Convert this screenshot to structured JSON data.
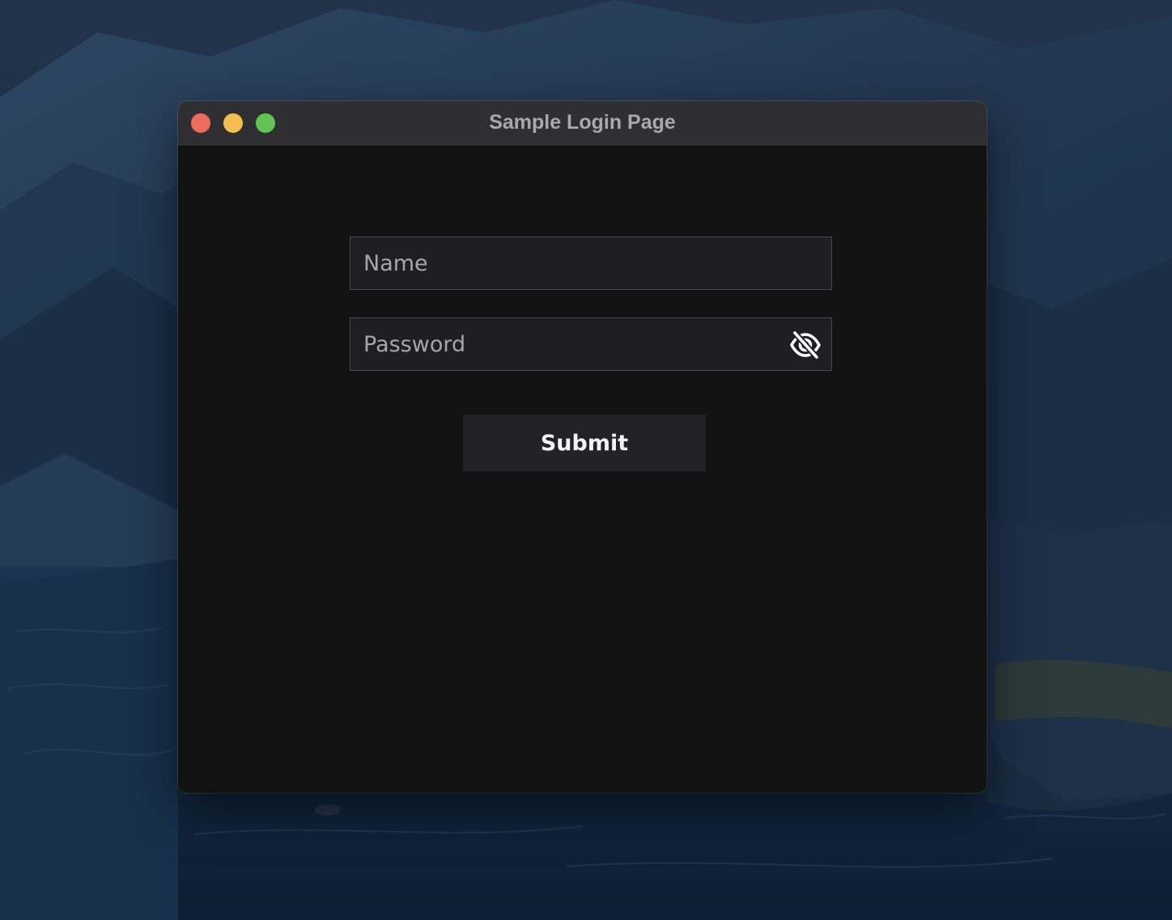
{
  "window": {
    "title": "Sample Login Page",
    "traffic_lights": [
      "close",
      "minimize",
      "zoom"
    ]
  },
  "form": {
    "name_placeholder": "Name",
    "name_value": "",
    "password_placeholder": "Password",
    "password_value": "",
    "visibility_icon": "eye-off-icon",
    "submit_label": "Submit"
  },
  "colors": {
    "titlebar": "#2f2f31",
    "window_bg": "#121212",
    "field_bg": "#1f1f21",
    "button_bg": "#232326",
    "close": "#ec6a5e",
    "minimize": "#f4bf4f",
    "zoom": "#61c554"
  }
}
